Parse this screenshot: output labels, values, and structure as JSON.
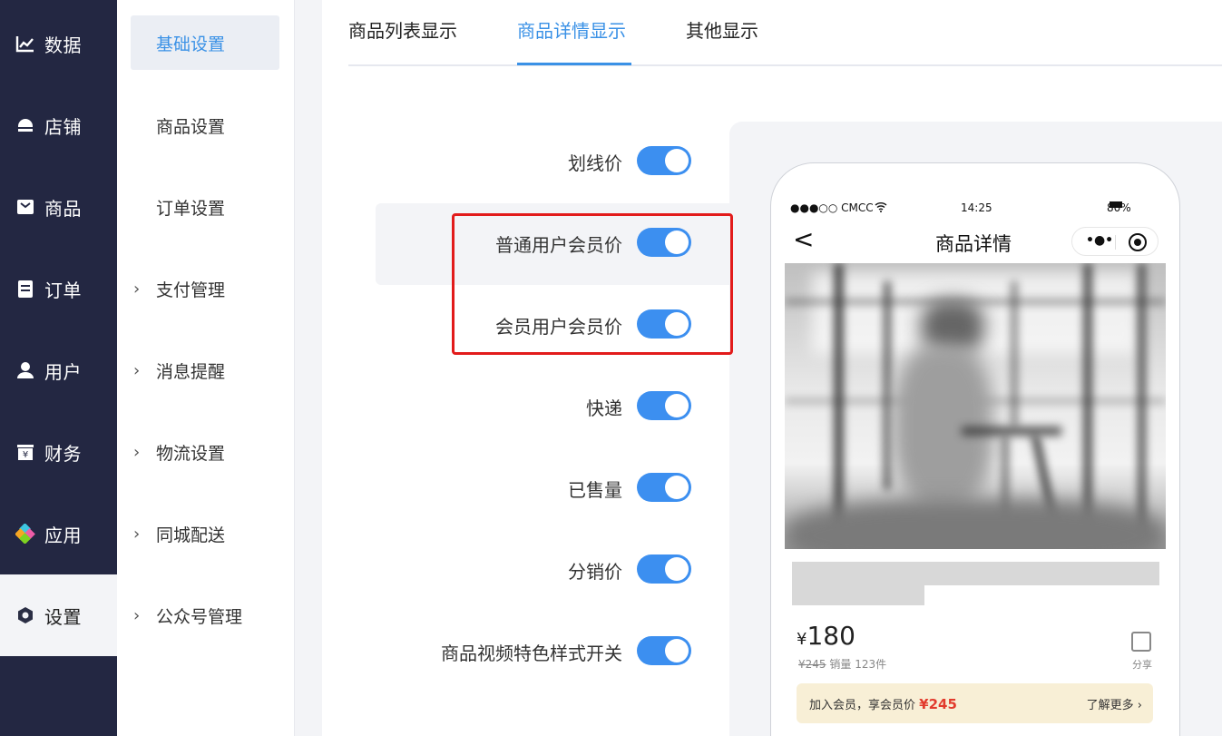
{
  "primary_nav": [
    {
      "label": "数据",
      "icon": "chart-line-icon"
    },
    {
      "label": "店铺",
      "icon": "shop-icon"
    },
    {
      "label": "商品",
      "icon": "goods-icon"
    },
    {
      "label": "订单",
      "icon": "order-icon"
    },
    {
      "label": "用户",
      "icon": "user-icon"
    },
    {
      "label": "财务",
      "icon": "finance-icon"
    },
    {
      "label": "应用",
      "icon": "apps-icon"
    },
    {
      "label": "设置",
      "icon": "settings-icon",
      "active": true
    }
  ],
  "secondary_nav": [
    {
      "label": "基础设置",
      "active": true
    },
    {
      "label": "商品设置"
    },
    {
      "label": "订单设置"
    },
    {
      "label": "支付管理",
      "chevron": "›"
    },
    {
      "label": "消息提醒",
      "chevron": "›"
    },
    {
      "label": "物流设置",
      "chevron": "›"
    },
    {
      "label": "同城配送",
      "chevron": "›"
    },
    {
      "label": "公众号管理",
      "chevron": "›"
    }
  ],
  "tabs": [
    {
      "label": "商品列表显示"
    },
    {
      "label": "商品详情显示",
      "active": true
    },
    {
      "label": "其他显示"
    }
  ],
  "settings": [
    {
      "label": "划线价",
      "on": true
    },
    {
      "label": "普通用户会员价",
      "on": true
    },
    {
      "label": "会员用户会员价",
      "on": true
    },
    {
      "label": "快递",
      "on": true
    },
    {
      "label": "已售量",
      "on": true
    },
    {
      "label": "分销价",
      "on": true
    },
    {
      "label": "商品视频特色样式开关",
      "on": true
    }
  ],
  "preview": {
    "status_carrier": "●●●○○ CMCC",
    "status_time": "14:25",
    "status_battery": "80%",
    "nav_back": "<",
    "nav_title": "商品详情",
    "capsule_dots": "•●•",
    "price_symbol": "¥",
    "price_value": "180",
    "original_price": "¥245",
    "sales_text": "销量 123件",
    "share_label": "分享",
    "member_text": "加入会员，享会员价",
    "member_price": "¥245",
    "member_more": "了解更多 ›"
  },
  "colors": {
    "accent": "#3a91e6",
    "toggle_on": "#3c8ff0",
    "sidebar_bg": "#232742",
    "highlight_box": "#e21b1b",
    "member_bar_bg": "#f8efd6",
    "member_price": "#e23b2d"
  }
}
